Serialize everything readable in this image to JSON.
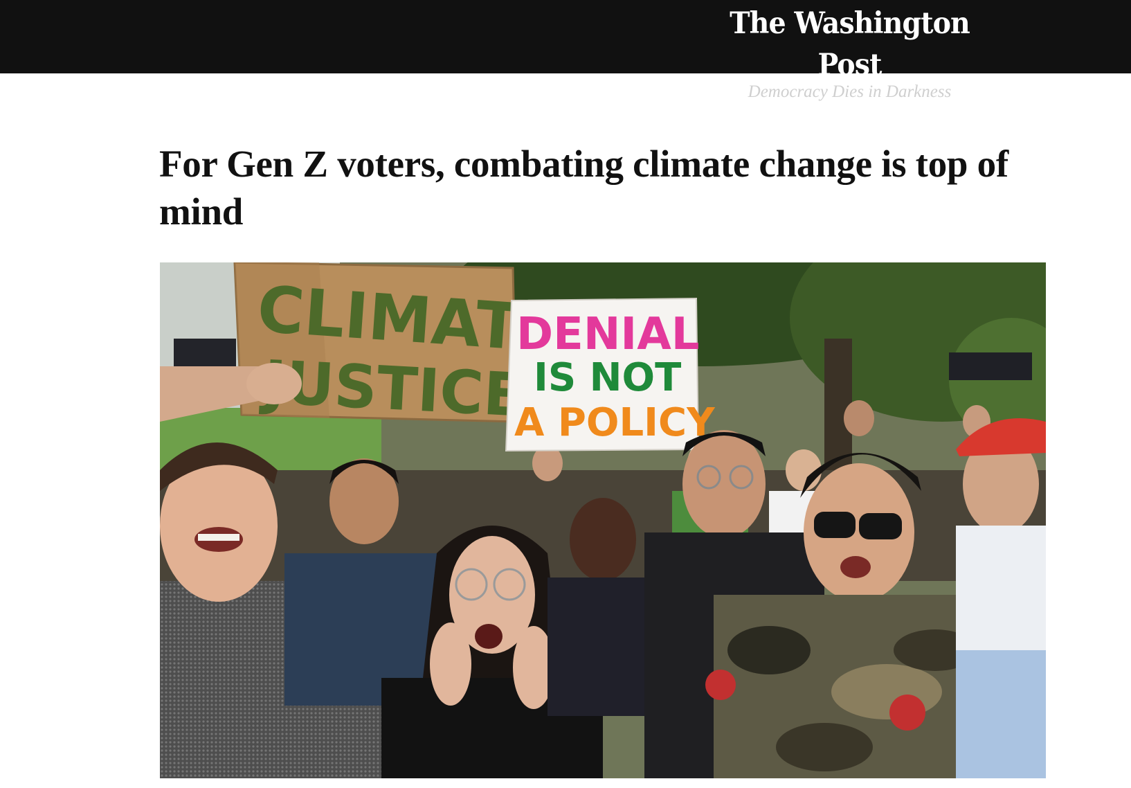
{
  "masthead": {
    "logo": "The Washington Post",
    "tagline": "Democracy Dies in Darkness"
  },
  "article": {
    "headline": "For Gen Z voters, combating climate change is top of mind"
  },
  "photo": {
    "sign_climate_line1": "CLIMATE",
    "sign_climate_line2": "JUSTICE!!",
    "sign_denial_line1": "DENIAL",
    "sign_denial_line2": "IS NOT",
    "sign_denial_line3": "A POLICY"
  },
  "colors": {
    "masthead_bg": "#111111",
    "headline": "#111111",
    "sign_pink": "#e3399b",
    "sign_red": "#e23a2c",
    "sign_green": "#1f8a3a",
    "sign_orange": "#f08a1c",
    "sign_blue": "#2a4fb8"
  }
}
